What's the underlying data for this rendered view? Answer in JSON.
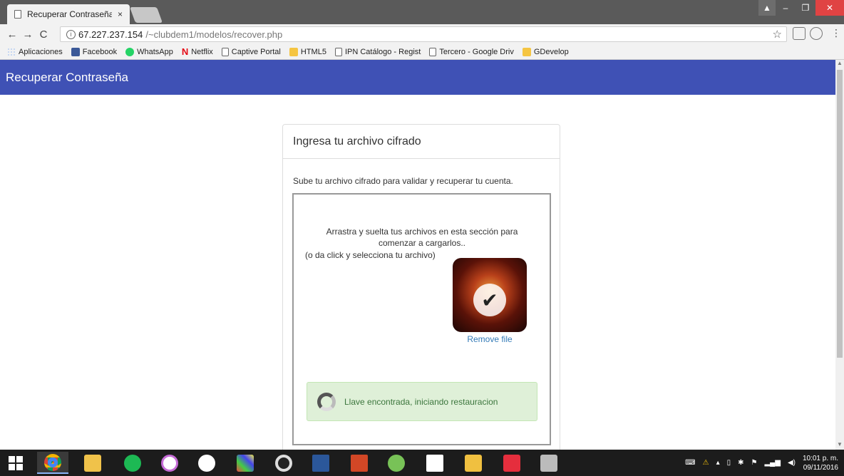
{
  "browser": {
    "tab_title": "Recuperar Contraseña",
    "tab_close": "×",
    "url_host": "67.227.237.154",
    "url_path": "/~clubdem1/modelos/recover.php",
    "bookmarks": [
      {
        "label": "Aplicaciones",
        "icon": "apps-icon"
      },
      {
        "label": "Facebook",
        "icon": "facebook-icon"
      },
      {
        "label": "WhatsApp",
        "icon": "whatsapp-icon"
      },
      {
        "label": "Netflix",
        "icon": "netflix-icon"
      },
      {
        "label": "Captive Portal",
        "icon": "page-icon"
      },
      {
        "label": "HTML5",
        "icon": "folder-icon"
      },
      {
        "label": "IPN Catálogo - Regist",
        "icon": "page-icon"
      },
      {
        "label": "Tercero - Google Driv",
        "icon": "page-icon"
      },
      {
        "label": "GDevelop",
        "icon": "folder-icon"
      }
    ]
  },
  "page": {
    "appbar_title": "Recuperar Contraseña",
    "panel_title": "Ingresa tu archivo cifrado",
    "panel_description": "Sube tu archivo cifrado para validar y recuperar tu cuenta.",
    "dropzone_message": "Arrastra y suelta tus archivos en esta sección para comenzar a cargarlos..",
    "dropzone_sub": "(o da click y selecciona tu archivo)",
    "remove_file_label": "Remove file",
    "alert_text": "Llave encontrada, iniciando restauracion"
  },
  "taskbar": {
    "time": "10:01 p. m.",
    "date": "09/11/2016"
  },
  "colors": {
    "appbar": "#3f51b5",
    "alert_bg": "#dff0d8",
    "alert_text": "#3c763d",
    "link": "#337ab7"
  }
}
